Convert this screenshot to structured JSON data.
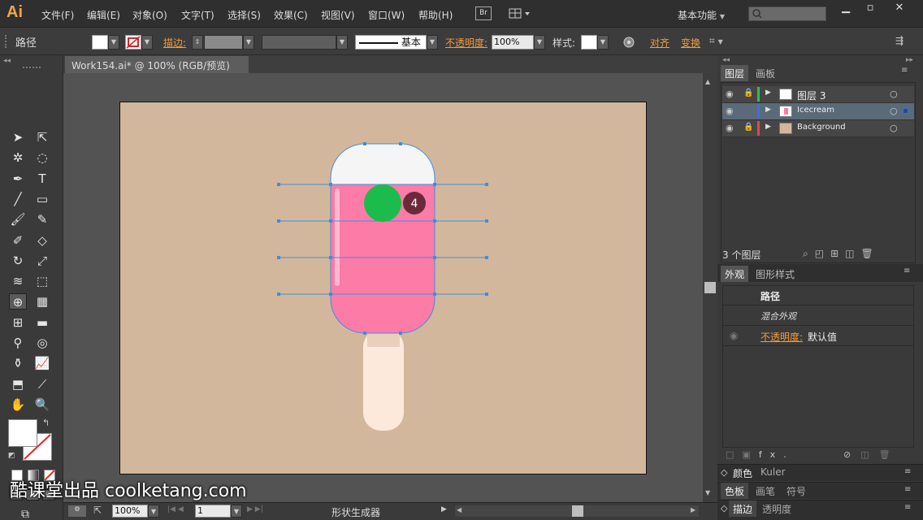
{
  "app": {
    "logo": "Ai"
  },
  "menu": {
    "items": [
      "文件(F)",
      "编辑(E)",
      "对象(O)",
      "文字(T)",
      "选择(S)",
      "效果(C)",
      "视图(V)",
      "窗口(W)",
      "帮助(H)"
    ],
    "br": "Br",
    "workspace": "基本功能"
  },
  "control": {
    "object_type": "路径",
    "stroke_label": "描边:",
    "stroke_style": "基本",
    "opacity_label": "不透明度:",
    "opacity_value": "100%",
    "style_label": "样式:",
    "align_label": "对齐",
    "transform_label": "变换"
  },
  "document": {
    "tab_title": "Work154.ai* @ 100% (RGB/预览)"
  },
  "canvas": {
    "step_badge": "4"
  },
  "colors": {
    "artboard": "#d3b79c",
    "icecream_pink": "#fd7ba7",
    "icecream_top": "#f5f5f5",
    "stick": "#fde9dc",
    "green": "#1cbc4c",
    "badge": "#6b2a3a",
    "guide": "#3b8fe0"
  },
  "layers": {
    "tabs": [
      "图层",
      "画板"
    ],
    "rows": [
      {
        "name": "图层 3",
        "color": "#2fc04a"
      },
      {
        "name": "Icecream",
        "color": "#3b6fe0"
      },
      {
        "name": "Background",
        "color": "#e04848"
      }
    ],
    "count": "3 个图层"
  },
  "appearance": {
    "tabs": [
      "外观",
      "图形样式"
    ],
    "title": "路径",
    "mixed": "混合外观",
    "opacity_label": "不透明度:",
    "opacity_value": "默认值"
  },
  "panels": {
    "color_tabs": [
      "颜色",
      "Kuler"
    ],
    "swatch_tabs": [
      "色板",
      "画笔",
      "符号"
    ],
    "stroke_tabs": [
      "描边",
      "透明度"
    ]
  },
  "status": {
    "zoom": "100%",
    "page": "1",
    "tool_name": "形状生成器"
  },
  "watermark": "酷课堂出品 coolketang.com"
}
